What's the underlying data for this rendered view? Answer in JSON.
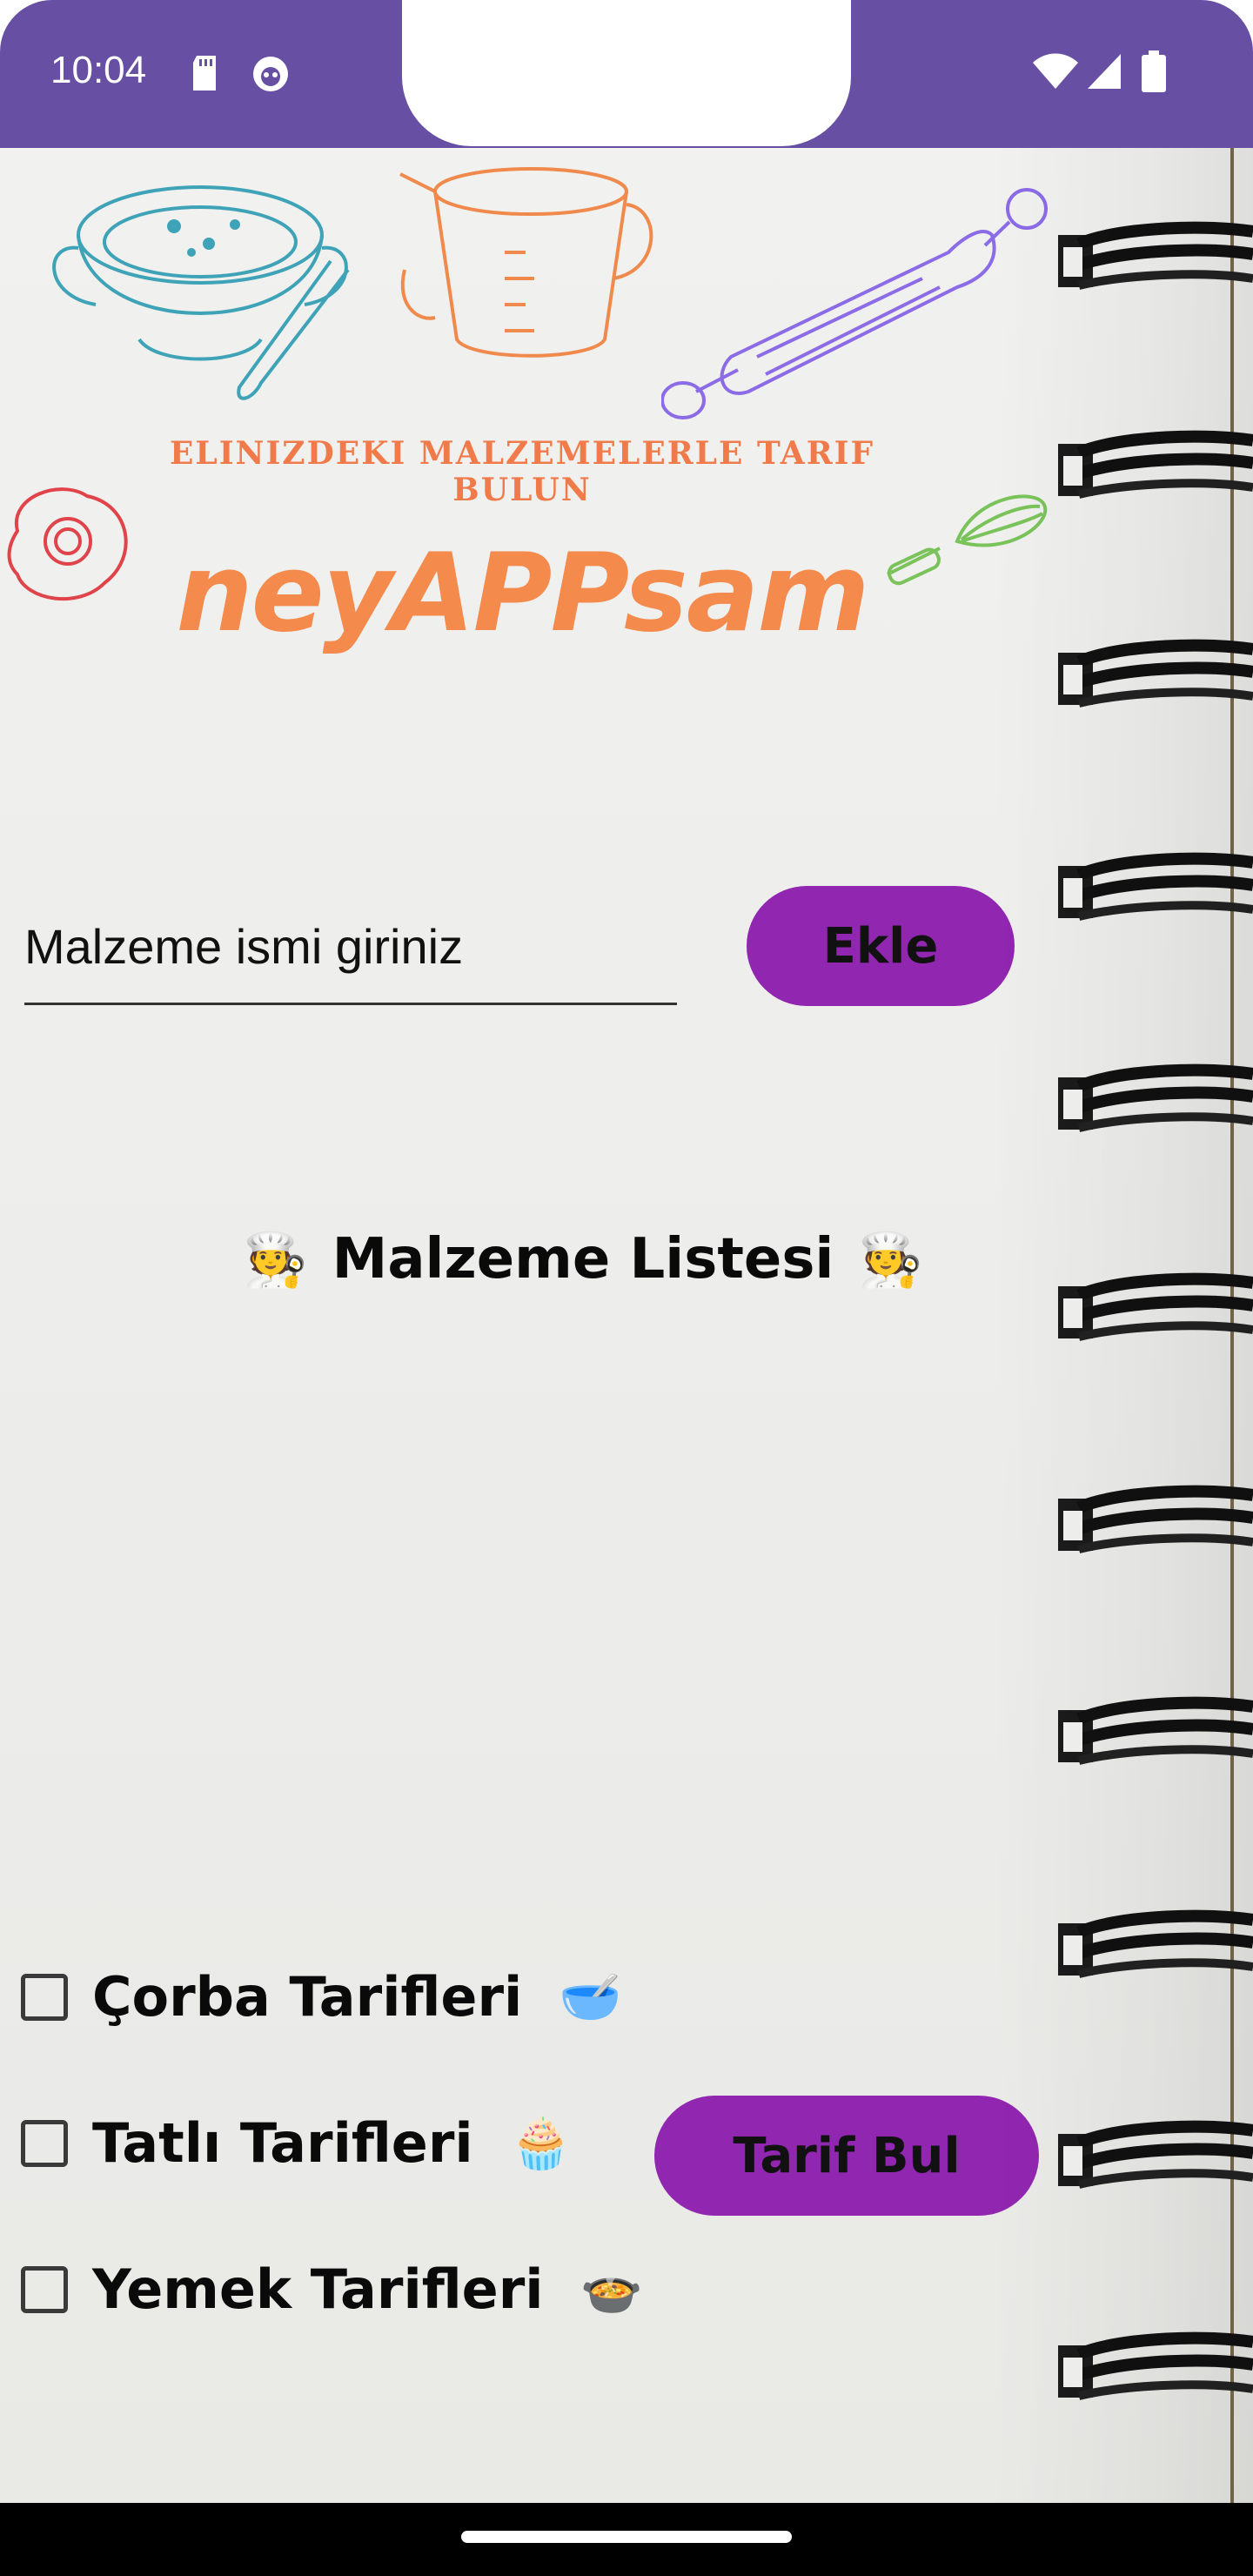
{
  "status_bar": {
    "time": "10:04",
    "background": "#6750A4",
    "left_icons": [
      "sd-card-icon",
      "notification-app-icon"
    ],
    "right_icons": [
      "wifi-icon",
      "cell-signal-icon",
      "battery-icon"
    ]
  },
  "header": {
    "subtitle": "ELINIZDEKI MALZEMELERLE TARIF BULUN",
    "logo": "neyAPPsam",
    "logo_color": "#F48A4C"
  },
  "ingredient_form": {
    "placeholder": "Malzeme ismi giriniz",
    "value": "",
    "add_label": "Ekle"
  },
  "ingredient_list": {
    "title": "Malzeme Listesi",
    "title_emoji": "🧑‍🍳",
    "items": []
  },
  "categories": [
    {
      "label": "Çorba Tarifleri",
      "emoji": "🥣",
      "checked": false
    },
    {
      "label": "Tatlı Tarifleri",
      "emoji": "🧁",
      "checked": false
    },
    {
      "label": "Yemek Tarifleri",
      "emoji": "🍲",
      "checked": false
    }
  ],
  "find_button": {
    "label": "Tarif Bul"
  },
  "colors": {
    "button": "#9126B0",
    "accent": "#6750A4"
  }
}
